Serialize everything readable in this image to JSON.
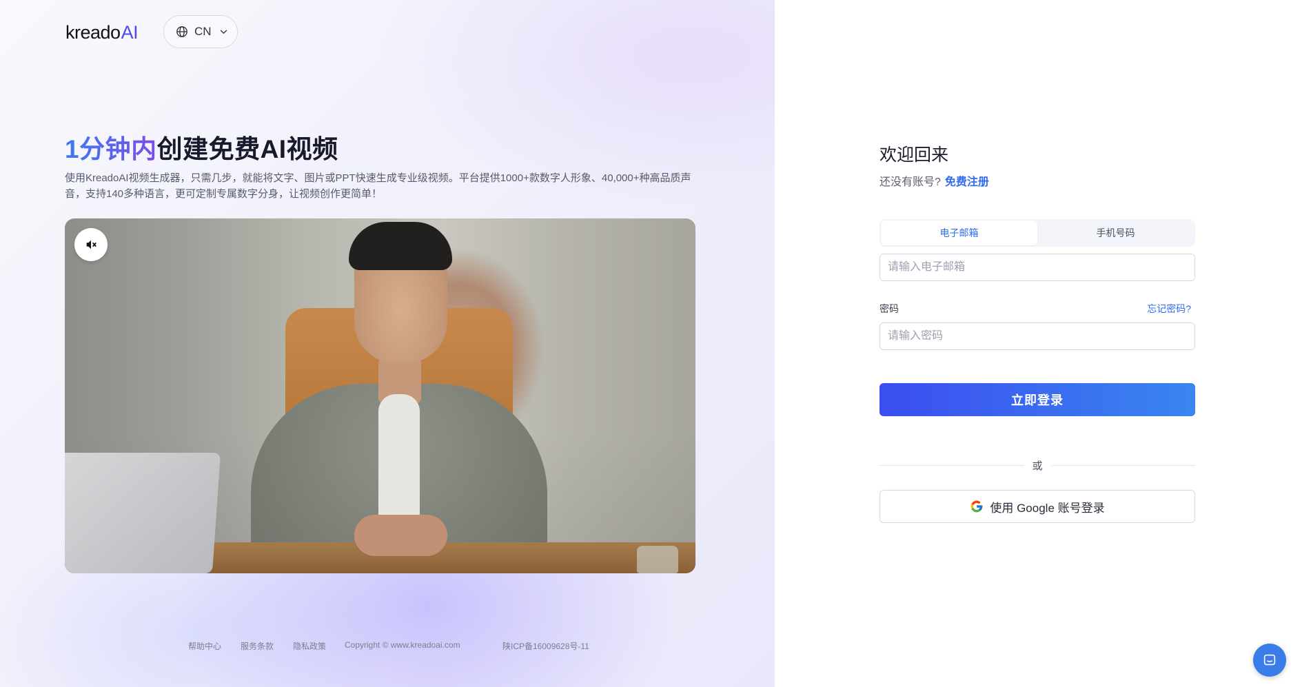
{
  "brand": {
    "logo_main": "kreado",
    "logo_ai": "AI"
  },
  "language": {
    "code": "CN"
  },
  "hero": {
    "headline_highlight": "1分钟内",
    "headline_rest": "创建免费AI视频",
    "description": "使用KreadoAI视频生成器，只需几步，就能将文字、图片或PPT快速生成专业级视频。平台提供1000+款数字人形象、40,000+种高品质声音，支持140多种语言，更可定制专属数字分身，让视频创作更简单！"
  },
  "footer": {
    "help": "帮助中心",
    "terms": "服务条款",
    "privacy": "隐私政策",
    "copyright": "Copyright © www.kreadoai.com",
    "icp": "陕ICP备16009628号-11"
  },
  "login": {
    "welcome": "欢迎回来",
    "no_account": "还没有账号?",
    "register_link": "免费注册",
    "tabs": [
      "电子邮箱",
      "手机号码"
    ],
    "active_tab": 0,
    "email_placeholder": "请输入电子邮箱",
    "password_label": "密码",
    "forgot_link": "忘记密码?",
    "password_placeholder": "请输入密码",
    "submit_label": "立即登录",
    "or_label": "或",
    "google_label": "使用 Google 账号登录"
  },
  "colors": {
    "accent": "#2f6cf0",
    "button_gradient_start": "#3b4df0",
    "button_gradient_end": "#3a86f0"
  }
}
